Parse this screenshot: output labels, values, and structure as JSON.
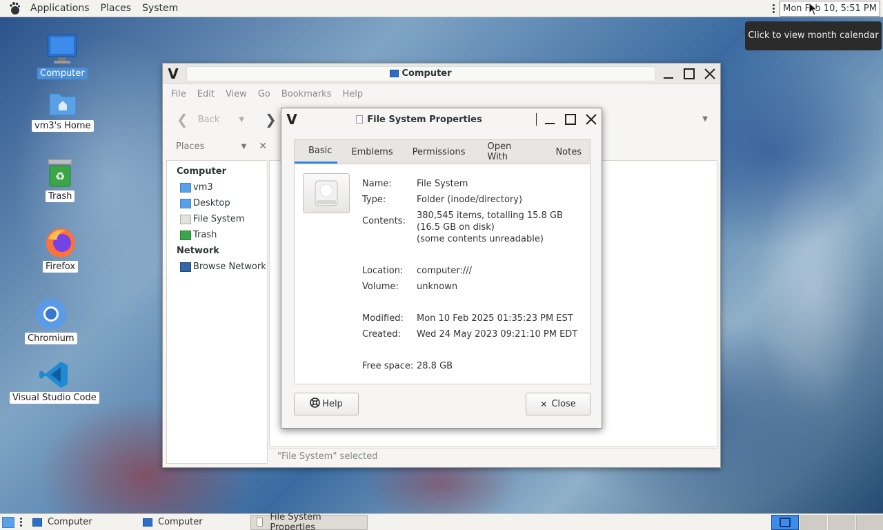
{
  "top_panel": {
    "menus": [
      "Applications",
      "Places",
      "System"
    ],
    "clock": "Mon Feb 10,  5:51 PM",
    "clock_tooltip": "Click to view month calendar"
  },
  "desktop_icons": [
    {
      "label": "Computer",
      "icon": "computer-icon",
      "selected": true
    },
    {
      "label": "vm3's Home",
      "icon": "home-folder-icon"
    },
    {
      "label": "Trash",
      "icon": "trash-icon"
    },
    {
      "label": "Firefox",
      "icon": "firefox-icon"
    },
    {
      "label": "Chromium",
      "icon": "chromium-icon"
    },
    {
      "label": "Visual Studio Code",
      "icon": "vscode-icon"
    }
  ],
  "file_manager": {
    "title": "Computer",
    "menu": [
      "File",
      "Edit",
      "View",
      "Go",
      "Bookmarks",
      "Help"
    ],
    "back_label": "Back",
    "sidebar_title": "Places",
    "sidebar": {
      "computer_heading": "Computer",
      "computer_items": [
        "vm3",
        "Desktop",
        "File System",
        "Trash"
      ],
      "network_heading": "Network",
      "network_items": [
        "Browse Network"
      ]
    },
    "status": "\"File System\" selected"
  },
  "dialog": {
    "title": "File System Properties",
    "tabs": [
      "Basic",
      "Emblems",
      "Permissions",
      "Open With",
      "Notes"
    ],
    "active_tab": "Basic",
    "props": {
      "name_label": "Name:",
      "name": "File System",
      "type_label": "Type:",
      "type": "Folder (inode/directory)",
      "contents_label": "Contents:",
      "contents_1": "380,545 items, totalling 15.8 GB",
      "contents_2": "(16.5 GB on disk)",
      "contents_3": "(some contents unreadable)",
      "location_label": "Location:",
      "location": "computer:///",
      "volume_label": "Volume:",
      "volume": "unknown",
      "modified_label": "Modified:",
      "modified": "Mon 10 Feb 2025 01:35:23 PM EST",
      "created_label": "Created:",
      "created": "Wed 24 May 2023 09:21:10 PM EDT",
      "free_label": "Free space:",
      "free": "28.8 GB"
    },
    "help_label": "Help",
    "close_label": "Close"
  },
  "taskbar": {
    "tasks": [
      "Computer",
      "Computer",
      "File System Properties"
    ],
    "active_task": "File System Properties"
  },
  "colors": {
    "accent": "#3584e4",
    "panel_bg": "#f4f2ee"
  }
}
